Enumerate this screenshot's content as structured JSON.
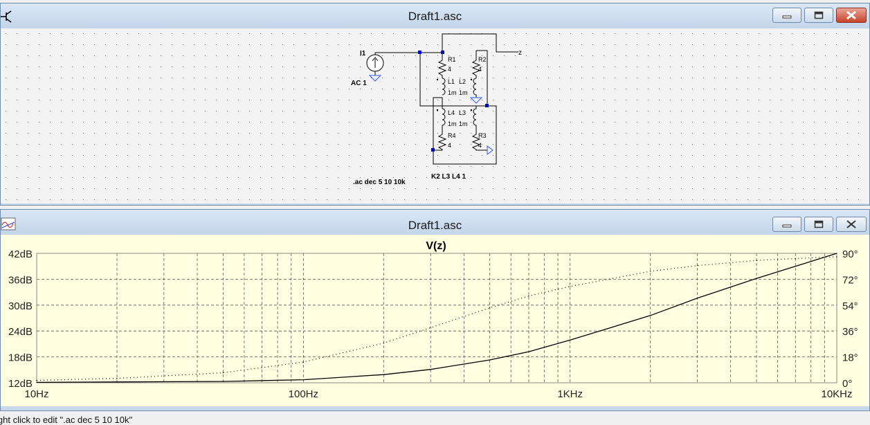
{
  "schematic_window": {
    "title": "Draft1.asc",
    "icon": "transistor-icon",
    "labels": {
      "source_name": "I1",
      "source_value": "AC 1",
      "node_z": "z",
      "r1": "R1",
      "r1_val": "4",
      "r2": "R2",
      "r2_val": "4",
      "l1": "L1",
      "l2": "L2",
      "l1_val": "1m",
      "l2_val": "1m",
      "l4": "L4",
      "l3": "L3",
      "l4_val": "1m",
      "l3_val": "1m",
      "r4": "R4",
      "r4_val": "4",
      "r3": "R3",
      "r3_val": "4",
      "directive_ac": ".ac dec 5 10 10k",
      "directive_k": "K2 L3 L4 1"
    }
  },
  "plot_window": {
    "title": "Draft1.asc",
    "icon": "waveform-icon"
  },
  "window_buttons": {
    "minimize": "minimize-icon",
    "maximize": "maximize-icon",
    "close": "close-icon"
  },
  "colors": {
    "plot_bg": "#ffffe1",
    "schematic_bg": "#f3f3f3",
    "close_red": "#c7432b",
    "wire": "#000000",
    "node": "#0000cc",
    "ground": "#3355ff"
  },
  "chart_data": {
    "type": "line",
    "title": "V(z)",
    "x_scale": "log",
    "xlim": [
      10,
      10000
    ],
    "x_ticks": [
      "10Hz",
      "100Hz",
      "1KHz",
      "10KHz"
    ],
    "y_left_ticks": [
      "12dB",
      "18dB",
      "24dB",
      "30dB",
      "36dB",
      "42dB"
    ],
    "ylim_left": [
      12,
      42
    ],
    "y_right_ticks": [
      "0°",
      "18°",
      "36°",
      "54°",
      "72°",
      "90°"
    ],
    "ylim_right": [
      0,
      90
    ],
    "grid": true,
    "series": [
      {
        "style": "solid",
        "axis": "left",
        "x": [
          10,
          20,
          50,
          100,
          200,
          300,
          500,
          700,
          1000,
          2000,
          3000,
          5000,
          7000,
          10000
        ],
        "y": [
          12.1,
          12.2,
          12.3,
          12.7,
          13.9,
          15.1,
          17.3,
          19.2,
          21.9,
          27.6,
          31.6,
          36.2,
          39.0,
          42.0
        ]
      },
      {
        "style": "dotted",
        "axis": "right",
        "x": [
          10,
          20,
          50,
          100,
          200,
          300,
          500,
          700,
          1000,
          2000,
          3000,
          5000,
          7000,
          10000
        ],
        "y": [
          1.7,
          3.1,
          7.0,
          14.4,
          27.6,
          38.3,
          52.1,
          60.4,
          67.0,
          77.5,
          81.5,
          85.1,
          86.4,
          87.6
        ]
      }
    ]
  },
  "status_bar": {
    "text": "ight click to edit \".ac dec 5 10 10k\""
  }
}
